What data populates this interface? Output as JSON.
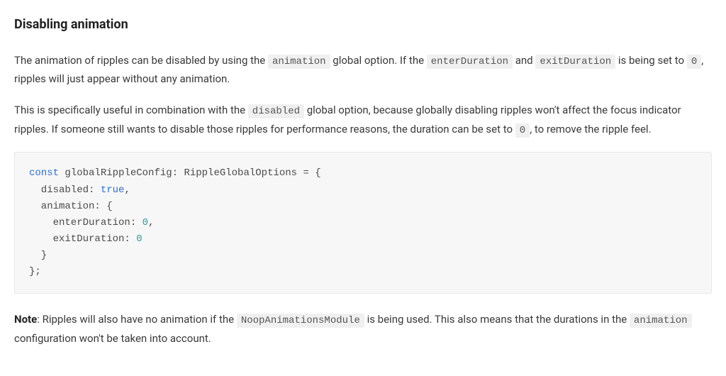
{
  "heading": "Disabling animation",
  "para1": {
    "t1": "The animation of ripples can be disabled by using the ",
    "c1": "animation",
    "t2": " global option. If the ",
    "c2": "enterDuration",
    "t3": " and ",
    "c3": "exitDuration",
    "t4": " is being set to ",
    "c4": "0",
    "t5": ", ripples will just appear without any animation."
  },
  "para2": {
    "t1": "This is specifically useful in combination with the ",
    "c1": "disabled",
    "t2": " global option, because globally disabling ripples won't affect the focus indicator ripples. If someone still wants to disable those ripples for performance reasons, the duration can be set to ",
    "c2": "0",
    "t3": ", to remove the ripple feel."
  },
  "code": {
    "kw_const": "const",
    "line1_rest": " globalRippleConfig: RippleGlobalOptions = {",
    "line2_a": "  disabled: ",
    "line2_bool": "true",
    "line2_b": ",",
    "line3": "  animation: {",
    "line4_a": "    enterDuration: ",
    "line4_num": "0",
    "line4_b": ",",
    "line5_a": "    exitDuration: ",
    "line5_num": "0",
    "line6": "  }",
    "line7": "};"
  },
  "para3": {
    "strong": "Note",
    "t1": ": Ripples will also have no animation if the ",
    "c1": "NoopAnimationsModule",
    "t2": " is being used. This also means that the durations in the ",
    "c2": "animation",
    "t3": " configuration won't be taken into account."
  }
}
